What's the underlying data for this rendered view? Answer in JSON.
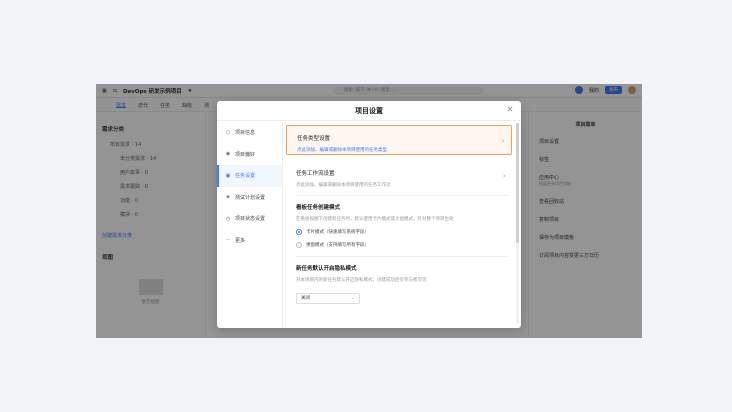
{
  "app": {
    "project_name": "DevOps 研发示例项目",
    "search_placeholder": "搜索 (按下 ⌘+K) 搜索...",
    "top_right": {
      "label": "我的",
      "publish": "发布"
    },
    "tabs": [
      "需求",
      "迭代",
      "任务",
      "缺陷",
      "测"
    ],
    "left": {
      "head": "需求分类",
      "all": "所有需求 · 14",
      "items": [
        "未分类需求 · 14",
        "用户故事 · 0",
        "需求跟踪 · 0",
        "功能 · 0",
        "模块 · 0"
      ],
      "link": "创建需求分类",
      "view_head": "视图",
      "empty": "暂无视图"
    },
    "right": {
      "head": "项目菜单",
      "items": [
        "项目设置",
        "标签",
        "应用中心",
        "查看回收站",
        "复制项目",
        "保存为项目模板",
        "订阅项目内容变更三方日历"
      ],
      "app_sub": "拓展更多项目功能"
    }
  },
  "modal": {
    "title": "项目设置",
    "nav": [
      {
        "icon": "box-icon",
        "glyph": "⬡",
        "label": "项目信息"
      },
      {
        "icon": "eye-icon",
        "glyph": "◉",
        "label": "项目偏好"
      },
      {
        "icon": "task-icon",
        "glyph": "▣",
        "label": "任务设置"
      },
      {
        "icon": "flask-icon",
        "glyph": "◈",
        "label": "测试计划设置"
      },
      {
        "icon": "status-icon",
        "glyph": "◷",
        "label": "项目状态设置"
      },
      {
        "icon": "more-icon",
        "glyph": "⋯",
        "label": "更多"
      }
    ],
    "card1": {
      "title": "任务类型设置",
      "desc": "点此添加、编辑或删除本项目使用的任务类型"
    },
    "card2": {
      "title": "任务工作流设置",
      "desc": "点此添加、编辑或删除本项目使用的任务工作流"
    },
    "board": {
      "title": "看板任务创建模式",
      "desc": "在看板视图下创建新任务时，默认使用卡片模式或大窗模式，针对整个项目生效",
      "option1": "卡片模式（快速填写系统字段）",
      "option2": "弹窗模式（支持填写所有字段）"
    },
    "privacy": {
      "title": "新任务默认开启隐私模式",
      "desc": "对本项目内的新任务默认开启隐私模式，创建成功后仅参与者可见",
      "value": "关闭"
    }
  }
}
